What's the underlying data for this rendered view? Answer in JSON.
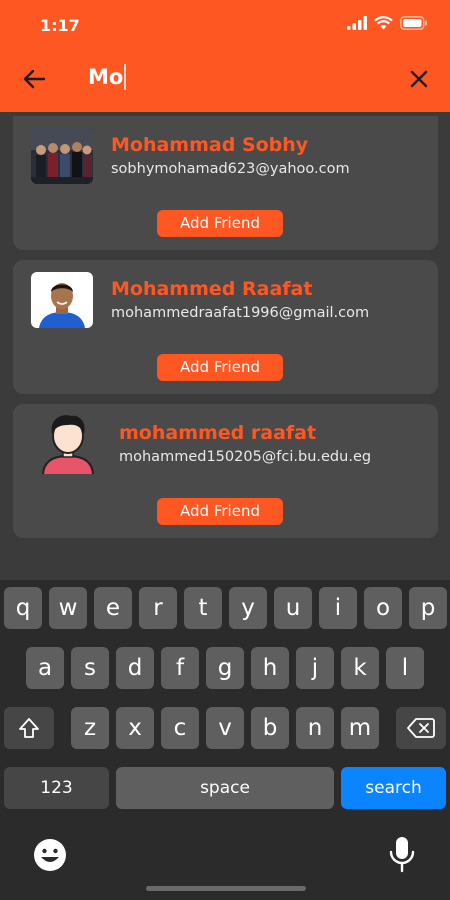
{
  "status_bar": {
    "time": "1:17"
  },
  "search": {
    "query": "Mo"
  },
  "results": [
    {
      "name": "Mohammad Sobhy",
      "email": "sobhymohamad623@yahoo.com",
      "action": "Add Friend"
    },
    {
      "name": "Mohammed Raafat",
      "email": "mohammedraafat1996@gmail.com",
      "action": "Add Friend"
    },
    {
      "name": "mohammed raafat",
      "email": "mohammed150205@fci.bu.edu.eg",
      "action": "Add Friend"
    }
  ],
  "keyboard": {
    "row1": [
      "q",
      "w",
      "e",
      "r",
      "t",
      "y",
      "u",
      "i",
      "o",
      "p"
    ],
    "row2": [
      "a",
      "s",
      "d",
      "f",
      "g",
      "h",
      "j",
      "k",
      "l"
    ],
    "row3": [
      "z",
      "x",
      "c",
      "v",
      "b",
      "n",
      "m"
    ],
    "numbers_label": "123",
    "space_label": "space",
    "search_label": "search"
  },
  "colors": {
    "accent": "#ff5722",
    "background": "#3b3b3b",
    "card": "#4a4a4a",
    "keyboard_action": "#0a84ff"
  },
  "icons": [
    "back-arrow-icon",
    "clear-icon",
    "signal-icon",
    "wifi-icon",
    "battery-icon",
    "shift-icon",
    "backspace-icon",
    "emoji-icon",
    "microphone-icon"
  ]
}
